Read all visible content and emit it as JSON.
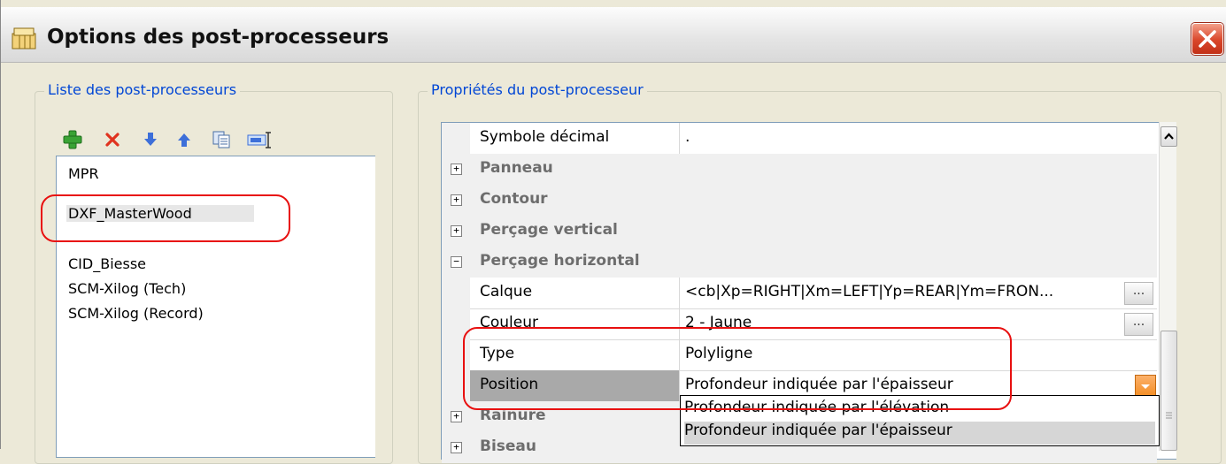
{
  "window": {
    "title": "Options des post-processeurs",
    "title_icon": "post-processor-app-icon",
    "close_icon": "close-icon"
  },
  "left_panel": {
    "legend": "Liste des post-processeurs",
    "toolbar_icons": [
      "add-icon",
      "delete-icon",
      "move-down-icon",
      "move-up-icon",
      "copy-icon",
      "rename-icon"
    ],
    "items": [
      {
        "label": "MPR",
        "selected": false
      },
      {
        "label": "DXF_MasterWood",
        "selected": true
      },
      {
        "label": "CID_Biesse",
        "selected": false
      },
      {
        "label": "SCM-Xilog (Tech)",
        "selected": false
      },
      {
        "label": "SCM-Xilog (Record)",
        "selected": false
      }
    ]
  },
  "right_panel": {
    "legend": "Propriétés du post-processeur",
    "rows": [
      {
        "kind": "prop",
        "name": "Symbole décimal",
        "value": "."
      },
      {
        "kind": "cat",
        "name": "Panneau",
        "expanded": false
      },
      {
        "kind": "cat",
        "name": "Contour",
        "expanded": false
      },
      {
        "kind": "cat",
        "name": "Perçage vertical",
        "expanded": false
      },
      {
        "kind": "cat",
        "name": "Perçage horizontal",
        "expanded": true
      },
      {
        "kind": "prop",
        "name": "Calque",
        "value": "<cb|Xp=RIGHT|Xm=LEFT|Yp=REAR|Ym=FRON...",
        "ellipsis": "..."
      },
      {
        "kind": "prop",
        "name": "Couleur",
        "value": "2 - Jaune",
        "ellipsis": "..."
      },
      {
        "kind": "prop",
        "name": "Type",
        "value": "Polyligne"
      },
      {
        "kind": "prop",
        "name": "Position",
        "value": "Profondeur indiquée par l'épaisseur",
        "editing": true
      },
      {
        "kind": "cat",
        "name": "Rainure",
        "expanded": false
      },
      {
        "kind": "cat",
        "name": "Biseau",
        "expanded": false
      }
    ],
    "dropdown_options": [
      {
        "label": "Profondeur indiquée par l'élévation",
        "highlighted": false
      },
      {
        "label": "Profondeur indiquée par l'épaisseur",
        "highlighted": true
      }
    ]
  },
  "colors": {
    "legend_blue": "#0046d5",
    "annotation_red": "#e81010",
    "dropdown_button_orange": "#f28a1c",
    "window_bg": "#ece9d8"
  }
}
